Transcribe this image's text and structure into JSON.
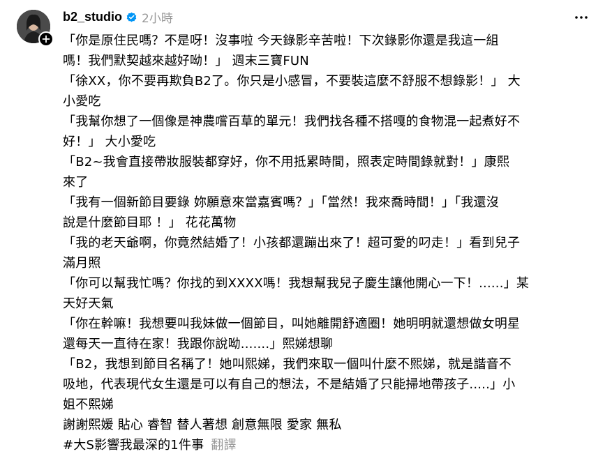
{
  "post": {
    "username": "b2_studio",
    "time": "2小時",
    "lines": [
      "「你是原住民嗎？不是呀！沒事啦 今天錄影辛苦啦！下次錄影你還是我這一組",
      "嗎！我們默契越來越好呦！」 週末三寶FUN",
      "「徐XX，你不要再欺負B2了。你只是小感冒，不要裝這麼不舒服不想錄影！」 大",
      "小愛吃",
      "「我幫你想了一個像是神農嚐百草的單元！我們找各種不搭嘎的食物混一起煮好不",
      "好！」 大小愛吃",
      "「B2~我會直接帶妝服裝都穿好，你不用抵累時間，照表定時間錄就對！」康熙",
      "來了",
      "「我有一個新節目要錄 妳願意來當嘉賓嗎？」「當然！我來喬時間！」「我還沒",
      "說是什麼節目耶 ！」 花花萬物",
      "「我的老天爺啊，你竟然結婚了！小孩都還蹦出來了！超可愛的叼走！」看到兒子",
      "滿月照",
      "「你可以幫我忙嗎？你找的到XXXX嗎！我想幫我兒子慶生讓他開心一下！......」某",
      "天好天氣",
      "「你在幹嘛！我想要叫我妹做一個節目，叫她離開舒適圈！她明明就還想做女明星",
      "還每天一直待在家！我跟你說呦.......」熙娣想聊",
      "「B2，我想到節目名稱了！她叫熙娣，我們來取一個叫什麼不熙娣，就是諧音不",
      "吸地，代表現代女生還是可以有自己的想法，不是結婚了只能掃地帶孩子.....」小",
      "姐不熙娣",
      "謝謝熙媛 貼心 睿智 替人著想 創意無限 愛家 無私"
    ],
    "hashtag": "#大S影響我最深的1件事",
    "translate_label": "翻譯"
  },
  "icons": {
    "avatar": "avatar",
    "follow": "plus-icon",
    "verified": "verified-badge-icon",
    "more": "more-horizontal-icon"
  },
  "colors": {
    "text": "#000000",
    "muted": "#999999",
    "verified": "#0095f6"
  }
}
